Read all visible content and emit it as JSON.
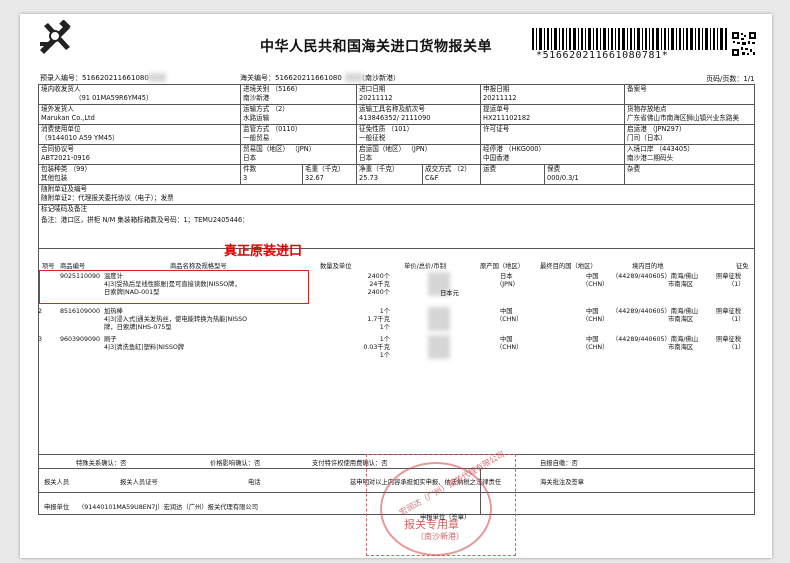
{
  "header": {
    "title": "中华人民共和国海关进口货物报关单",
    "barcode_text": "*516620211661080781*",
    "pre_entry_label": "预录入编号：",
    "pre_entry_no": "516620211661080",
    "customs_no_label": "海关编号：",
    "customs_no": "516620211661080",
    "port_name": "（南沙新港）",
    "page_label": "页码/页数：1/1"
  },
  "rows": {
    "r1": {
      "c1_label": "境内收发货人",
      "c1_value": "（91 01MA59R6YM45）",
      "c2_label": "进境关别",
      "c2_code": "（5166）",
      "c2_value": "南沙新港",
      "c3_label": "进口日期",
      "c3_value": "20211112",
      "c4_label": "申报日期",
      "c4_value": "20211112",
      "c5_label": "备案号",
      "c5_value": ""
    },
    "r2": {
      "c1_label": "境外发货人",
      "c1_value": "Marukan Co.,Ltd",
      "c2_label": "运输方式",
      "c2_code": "（2）",
      "c2_value": "水路运输",
      "c3_label": "运输工具名称及航次号",
      "c3_value": "413846352/ 2111090",
      "c4_label": "提运单号",
      "c4_value": "HX211102182",
      "c5_label": "货物存放地点",
      "c5_value": "广东省佛山市南海区狮山镇兴业东路美"
    },
    "r3": {
      "c1_label": "消费使用单位",
      "c1_value": "（9144010 A59 YM45）",
      "c2_label": "监管方式",
      "c2_code": "（0110）",
      "c2_value": "一般贸易",
      "c3_label": "征免性质",
      "c3_code": "（101）",
      "c3_value": "一般征税",
      "c4_label": "许可证号",
      "c4_value": "",
      "c5_label": "启运港",
      "c5_code": "（JPN297）",
      "c5_value": "门司（日本）"
    },
    "r4": {
      "c1_label": "合同协议号",
      "c1_value": "ABT2021-0916",
      "c2_label": "贸易国（地区）",
      "c2_code": "（JPN）",
      "c2_value": "日本",
      "c3_label": "启运国（地区）",
      "c3_code": "（JPN）",
      "c3_value": "日本",
      "c4_label": "经停港",
      "c4_code": "（HKG000）",
      "c4_value": "中国香港",
      "c5_label": "入境口岸",
      "c5_code": "（443405）",
      "c5_value": "南沙港二期码头"
    },
    "r5": {
      "pack_label": "包装种类",
      "pack_code": "（99）",
      "pack_value": "其他包装",
      "qty_label": "件数",
      "qty_value": "3",
      "gross_label": "毛重（千克）",
      "gross_value": "32.67",
      "net_label": "净重（千克）",
      "net_value": "25.73",
      "deal_label": "成交方式",
      "deal_code": "（2）",
      "deal_value": "C&F",
      "freight_label": "运费",
      "freight_value": "",
      "ins_label": "保费",
      "ins_value": "000/0.3/1",
      "misc_label": "杂费",
      "misc_value": ""
    },
    "r6": {
      "docs_label": "随附单证及编号",
      "docs_value": "随附单证2：代理报关委托协议（电子）；发票"
    },
    "r7": {
      "marks_label": "标记唛码及备注",
      "marks_value": "备注：港口区，拼柜 N/M   集装箱标箱数及号码：1；TEMU2405446："
    }
  },
  "overlay_caption": "真正原装进口",
  "goods_headers": [
    "项号",
    "商品编号",
    "商品名称及规格型号",
    "数量及单位",
    "单价/总价/币制",
    "原产国（地区）",
    "最终目的国（地区）",
    "境内目的地",
    "征免"
  ],
  "goods": [
    {
      "no": "1",
      "code": "9025110090",
      "name": [
        "温度计",
        "4|3|受热后呈线性膨胀|是可直接读数|NISSO牌，",
        "日索牌|NAD-001型"
      ],
      "qty": [
        "2400个",
        "24千克",
        "2400个"
      ],
      "currency": "日本元",
      "origin": [
        "日本",
        "（JPN）"
      ],
      "dest": [
        "中国",
        "（CHN）"
      ],
      "domestic": [
        "（44289/440605）南海/佛山",
        "市南海区"
      ],
      "levy": [
        "照章征税",
        "（1）"
      ]
    },
    {
      "no": "2",
      "code": "8516109000",
      "name": [
        "加热棒",
        "4|3|浸入式|通关发热丝，使电能转换为热能|NISSO",
        "牌，日索牌|NHS-075型"
      ],
      "qty": [
        "1个",
        "1.7千克",
        "1个"
      ],
      "currency": "",
      "origin": [
        "中国",
        "（CHN）"
      ],
      "dest": [
        "中国",
        "（CHN）"
      ],
      "domestic": [
        "（44289/440605）南海/佛山",
        "市南海区"
      ],
      "levy": [
        "照章征税",
        "（1）"
      ]
    },
    {
      "no": "3",
      "code": "9603909090",
      "name": [
        "刷子",
        "4|3|清洗鱼缸|塑料|NISSO牌"
      ],
      "qty": [
        "1个",
        "0.03千克",
        "1个"
      ],
      "currency": "",
      "origin": [
        "中国",
        "（CHN）"
      ],
      "dest": [
        "中国",
        "（CHN）"
      ],
      "domestic": [
        "（44289/440605）南海/佛山",
        "市南海区"
      ],
      "levy": [
        "照章征税",
        "（1）"
      ]
    }
  ],
  "confirm": {
    "special": "特殊关系确认：否",
    "price": "价格影响确认：否",
    "royalty": "支付特许权使用费确认：否",
    "self": "自报自缴：否"
  },
  "footer": {
    "declarant_label": "报关人员",
    "declarant_cert_label": "报关人员证号",
    "phone_label": "电话",
    "statement": "兹申明对以上内容承担如实申报、依法纳税之法律责任",
    "customs_label": "海关批注及签章",
    "unit_label": "申报单位",
    "unit_value": "（91440101MA59U8EN7J）宏润达（广州）报关代理有限公司",
    "unit_sign_label": "申报单位（签章）"
  },
  "stamp": {
    "ring_text": "宏润达（广州）报关代理有限公司",
    "center_text": "报关专用章",
    "sub_text": "（南沙新港）"
  }
}
